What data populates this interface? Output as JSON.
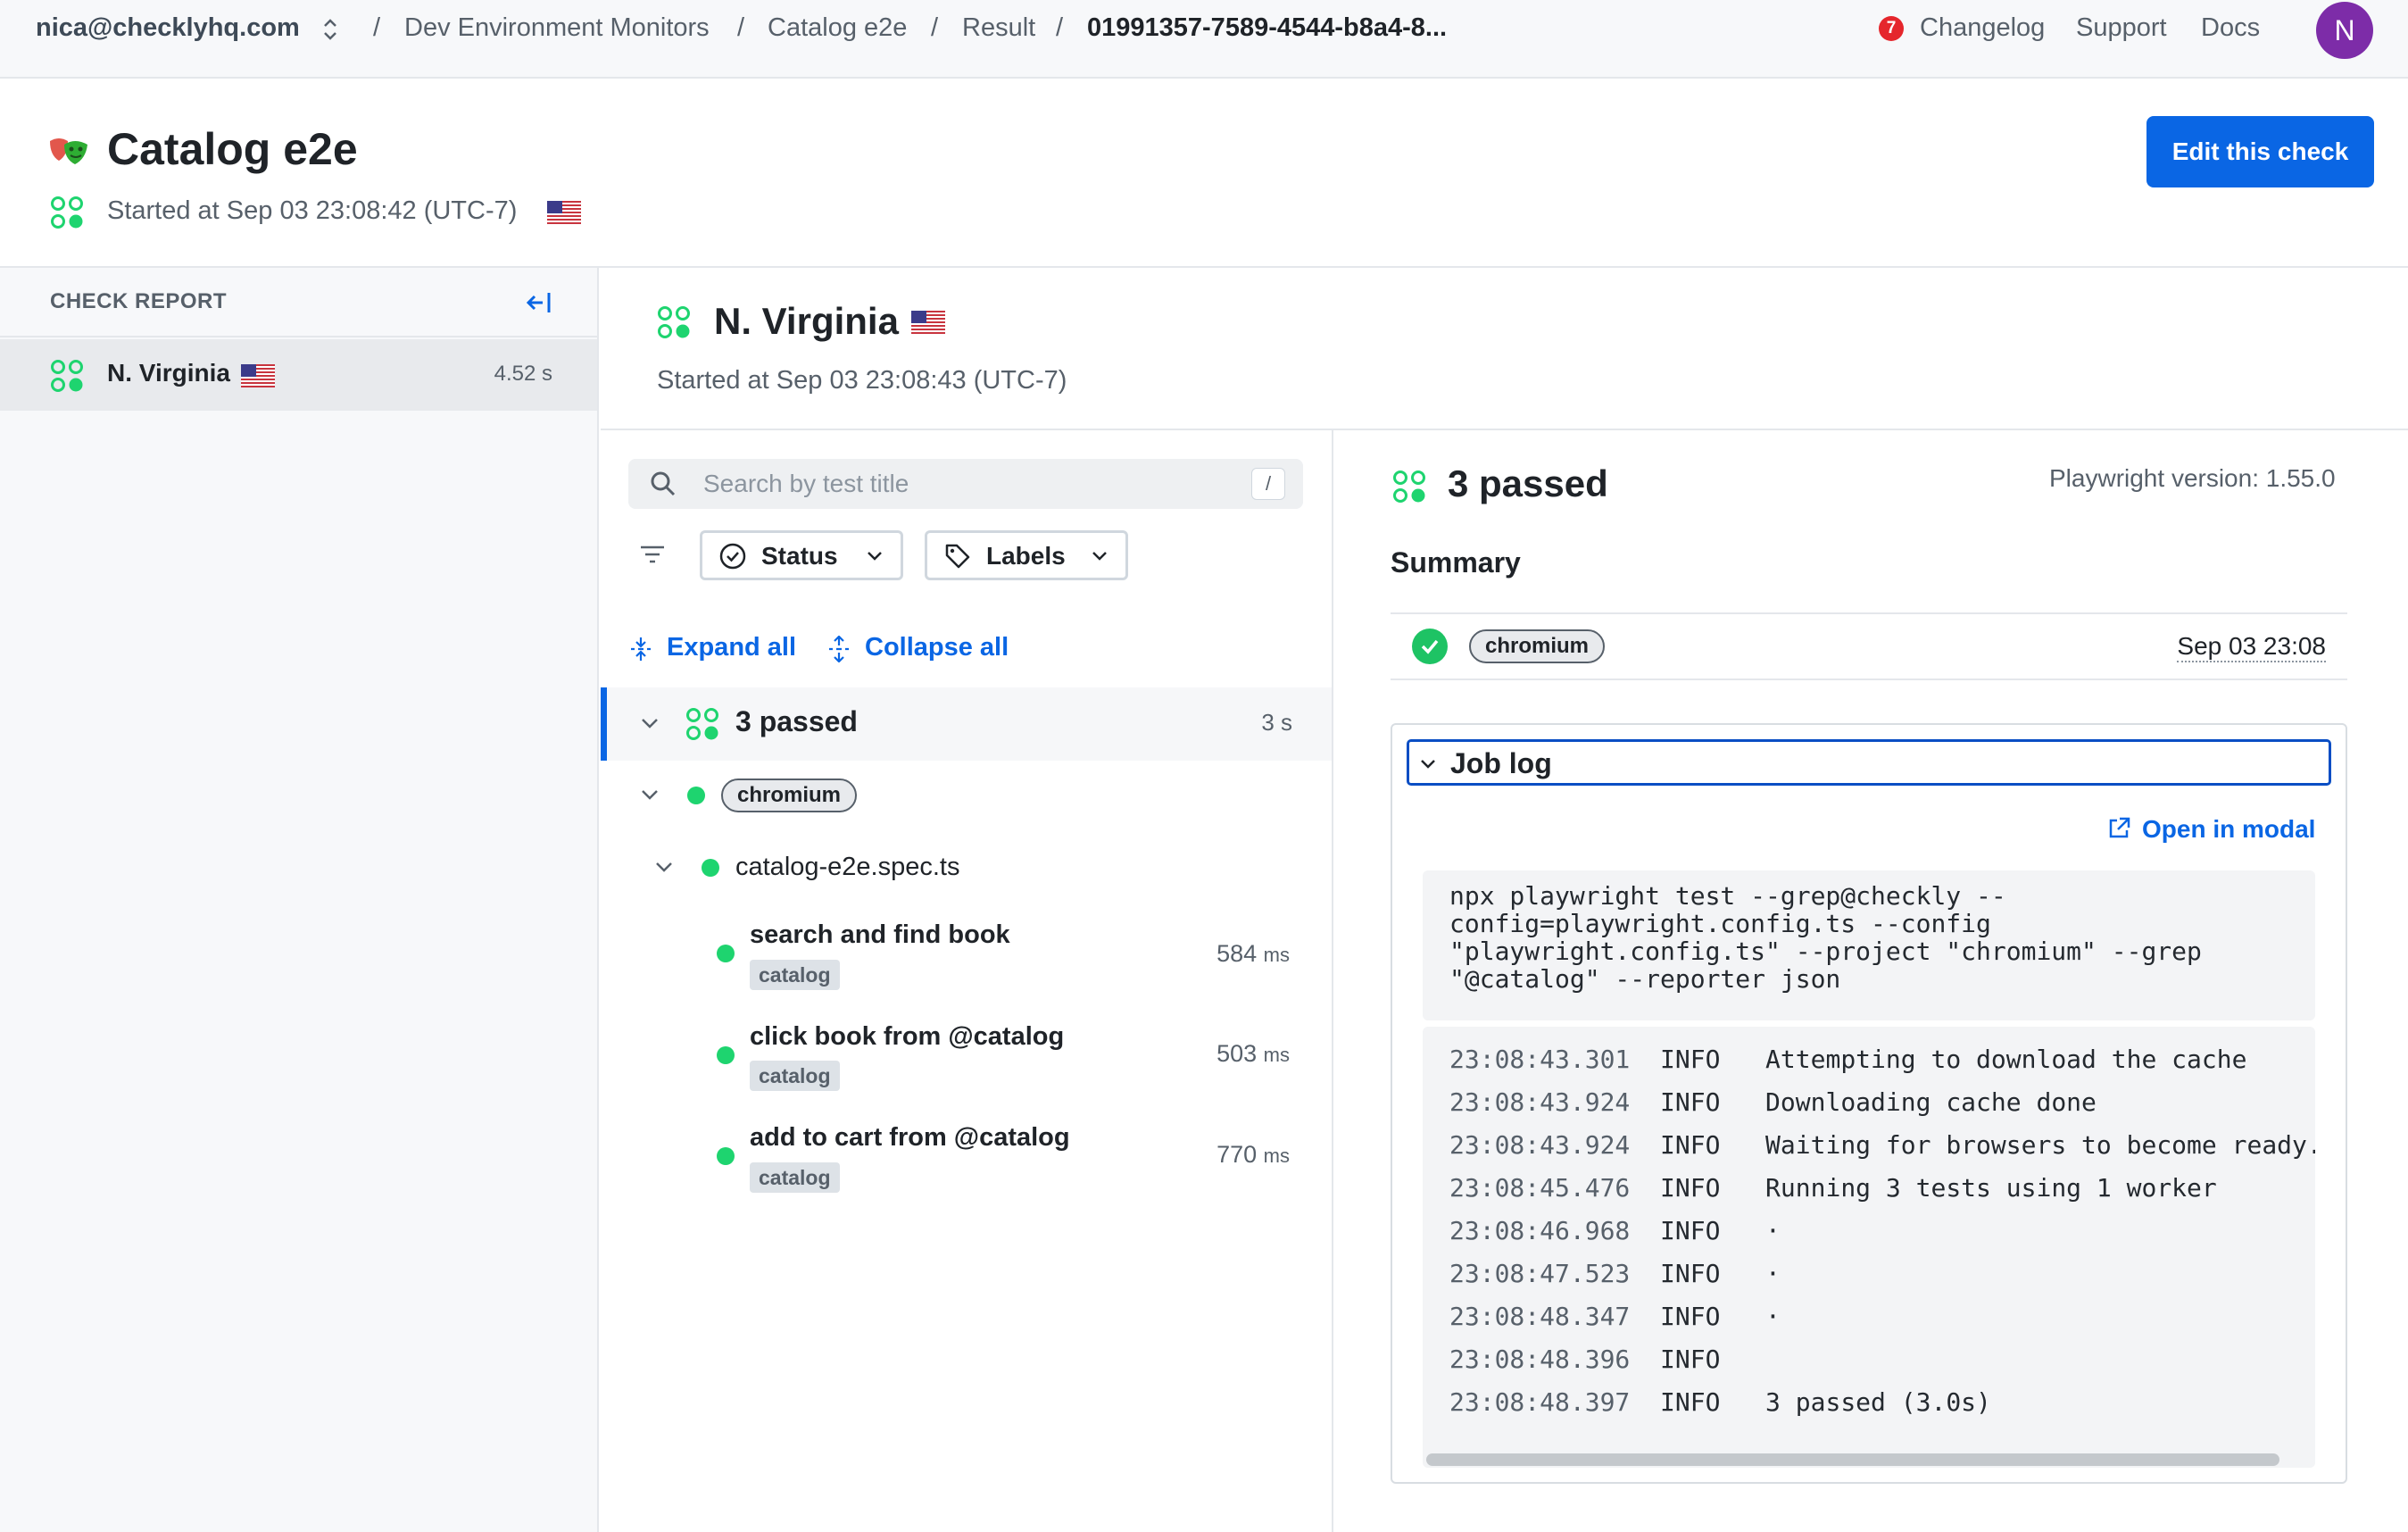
{
  "topbar": {
    "account": "nica@checklyhq.com",
    "breadcrumbs": [
      "Dev Environment Monitors",
      "Catalog e2e",
      "Result",
      "01991357-7589-4544-b8a4-8..."
    ],
    "changelog_count": "7",
    "links": [
      "Changelog",
      "Support",
      "Docs"
    ],
    "avatar_initial": "N"
  },
  "header": {
    "title": "Catalog e2e",
    "started": "Started at Sep 03 23:08:42 (UTC-7)",
    "edit_button": "Edit this check"
  },
  "sidebar": {
    "heading": "CHECK REPORT",
    "items": [
      {
        "name": "N. Virginia",
        "duration": "4.52 s"
      }
    ]
  },
  "region": {
    "name": "N. Virginia",
    "started": "Started at Sep 03 23:08:43 (UTC-7)"
  },
  "tests": {
    "search_placeholder": "Search by test title",
    "search_shortcut": "/",
    "filters": {
      "status": "Status",
      "labels": "Labels"
    },
    "expand_all": "Expand all",
    "collapse_all": "Collapse all",
    "suite": {
      "title": "3 passed",
      "duration": "3 s"
    },
    "project": "chromium",
    "file": "catalog-e2e.spec.ts",
    "items": [
      {
        "title": "search and find book",
        "tag": "catalog",
        "duration": "584",
        "unit": "ms"
      },
      {
        "title": "click book from @catalog",
        "tag": "catalog",
        "duration": "503",
        "unit": "ms"
      },
      {
        "title": "add to cart from @catalog",
        "tag": "catalog",
        "duration": "770",
        "unit": "ms"
      }
    ]
  },
  "result": {
    "title": "3 passed",
    "version": "Playwright version: 1.55.0",
    "summary_heading": "Summary",
    "summary_project": "chromium",
    "summary_date": "Sep 03 23:08",
    "joblog_title": "Job log",
    "open_in_modal": "Open in modal",
    "command_lines": [
      "npx playwright test --grep@checkly --",
      "config=playwright.config.ts --config",
      "\"playwright.config.ts\" --project \"chromium\" --grep",
      "\"@catalog\" --reporter json"
    ],
    "log": [
      {
        "ts": "23:08:43.301",
        "level": "INFO",
        "msg": "Attempting to download the cache"
      },
      {
        "ts": "23:08:43.924",
        "level": "INFO",
        "msg": "Downloading cache done"
      },
      {
        "ts": "23:08:43.924",
        "level": "INFO",
        "msg": "Waiting for browsers to become ready."
      },
      {
        "ts": "23:08:45.476",
        "level": "INFO",
        "msg": "Running 3 tests using 1 worker"
      },
      {
        "ts": "23:08:46.968",
        "level": "INFO",
        "msg": "·"
      },
      {
        "ts": "23:08:47.523",
        "level": "INFO",
        "msg": "·"
      },
      {
        "ts": "23:08:48.347",
        "level": "INFO",
        "msg": "·"
      },
      {
        "ts": "23:08:48.396",
        "level": "INFO",
        "msg": ""
      },
      {
        "ts": "23:08:48.397",
        "level": "INFO",
        "msg": "3 passed (3.0s)"
      }
    ]
  },
  "colors": {
    "accent": "#0a66e4",
    "success": "#1ed46f",
    "badge": "#e5262c",
    "avatar": "#7d2ca8"
  }
}
